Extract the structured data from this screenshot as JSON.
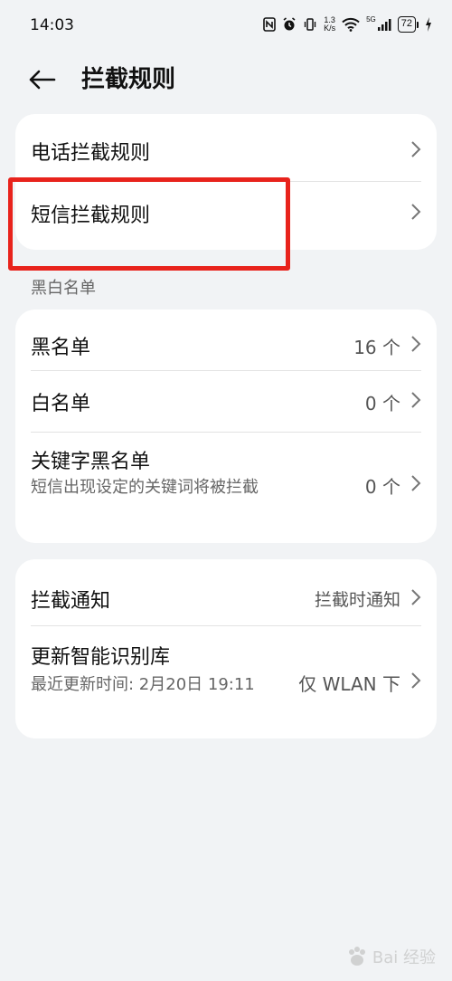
{
  "status_bar": {
    "time": "14:03",
    "net_speed_value": "1.3",
    "net_speed_unit": "K/s",
    "signal_label": "5G",
    "battery": "72"
  },
  "header": {
    "title": "拦截规则"
  },
  "rules_card": {
    "items": [
      {
        "label": "电话拦截规则"
      },
      {
        "label": "短信拦截规则"
      }
    ]
  },
  "blacklist_section": {
    "label": "黑白名单",
    "items": [
      {
        "label": "黑名单",
        "value": "16 个"
      },
      {
        "label": "白名单",
        "value": "0 个"
      },
      {
        "label": "关键字黑名单",
        "subtitle": "短信出现设定的关键词将被拦截",
        "value": "0 个"
      }
    ]
  },
  "notify_card": {
    "items": [
      {
        "label": "拦截通知",
        "value": "拦截时通知"
      },
      {
        "label": "更新智能识别库",
        "subtitle": "最近更新时间: 2月20日 19:11",
        "value": "仅 WLAN 下"
      }
    ]
  },
  "watermark": {
    "text": "Bai 经验"
  },
  "colors": {
    "background": "#f1f3f5",
    "card": "#ffffff",
    "highlight": "#e8231c",
    "text_primary": "#111111",
    "text_secondary": "#666666"
  }
}
